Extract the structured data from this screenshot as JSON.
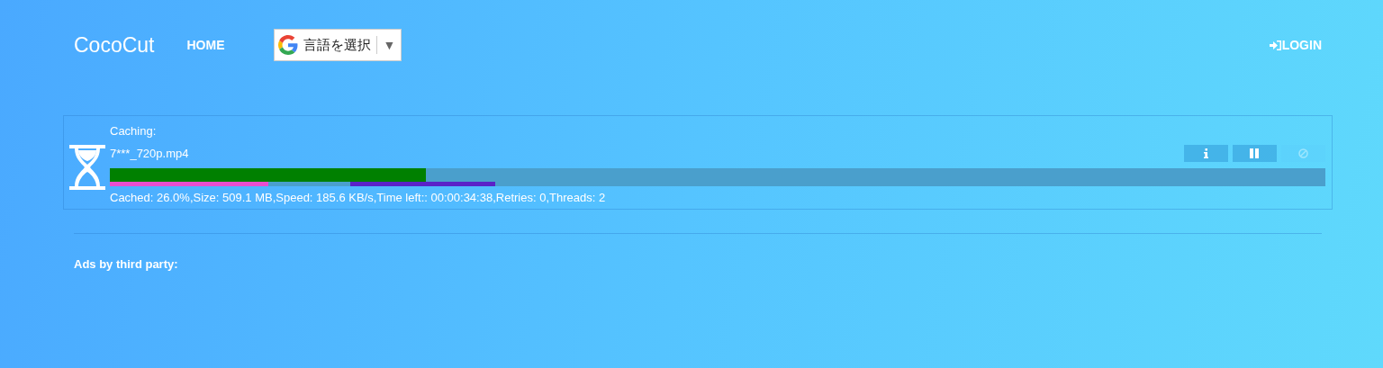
{
  "nav": {
    "brand": "CocoCut",
    "links": [
      "HOME"
    ],
    "language_select": {
      "label": "言語を選択",
      "arrow": "▼"
    },
    "login": "LOGIN"
  },
  "task": {
    "status": "Caching:",
    "file": "7***_720p.mp4",
    "level": 0.26,
    "threads": [
      {
        "color": "#e94ecf"
      },
      {
        "color": "#5a22c8"
      }
    ],
    "stats": "Cached: 26.0%,Size: 509.1 MB,Speed: 185.6 KB/s,Time left:: 00:00:34:38,Retries: 0,Threads: 2",
    "buttons": [
      {
        "kind": "info",
        "disabled": false
      },
      {
        "kind": "pause",
        "disabled": false
      },
      {
        "kind": "cancel",
        "disabled": true
      }
    ]
  },
  "ads_label": "Ads by third party:"
}
